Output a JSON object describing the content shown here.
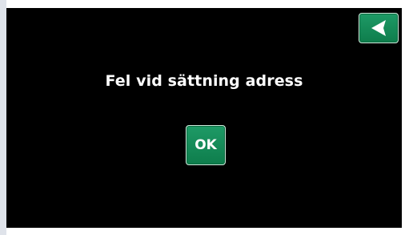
{
  "dialog": {
    "message": "Fel vid sättning adress",
    "ok_label": "OK"
  },
  "header": {
    "back_icon": "back-arrow-icon"
  },
  "colors": {
    "screen_background": "#000000",
    "button_green": "#138a56",
    "text": "#ffffff",
    "left_strip": "#dfe3ea"
  }
}
